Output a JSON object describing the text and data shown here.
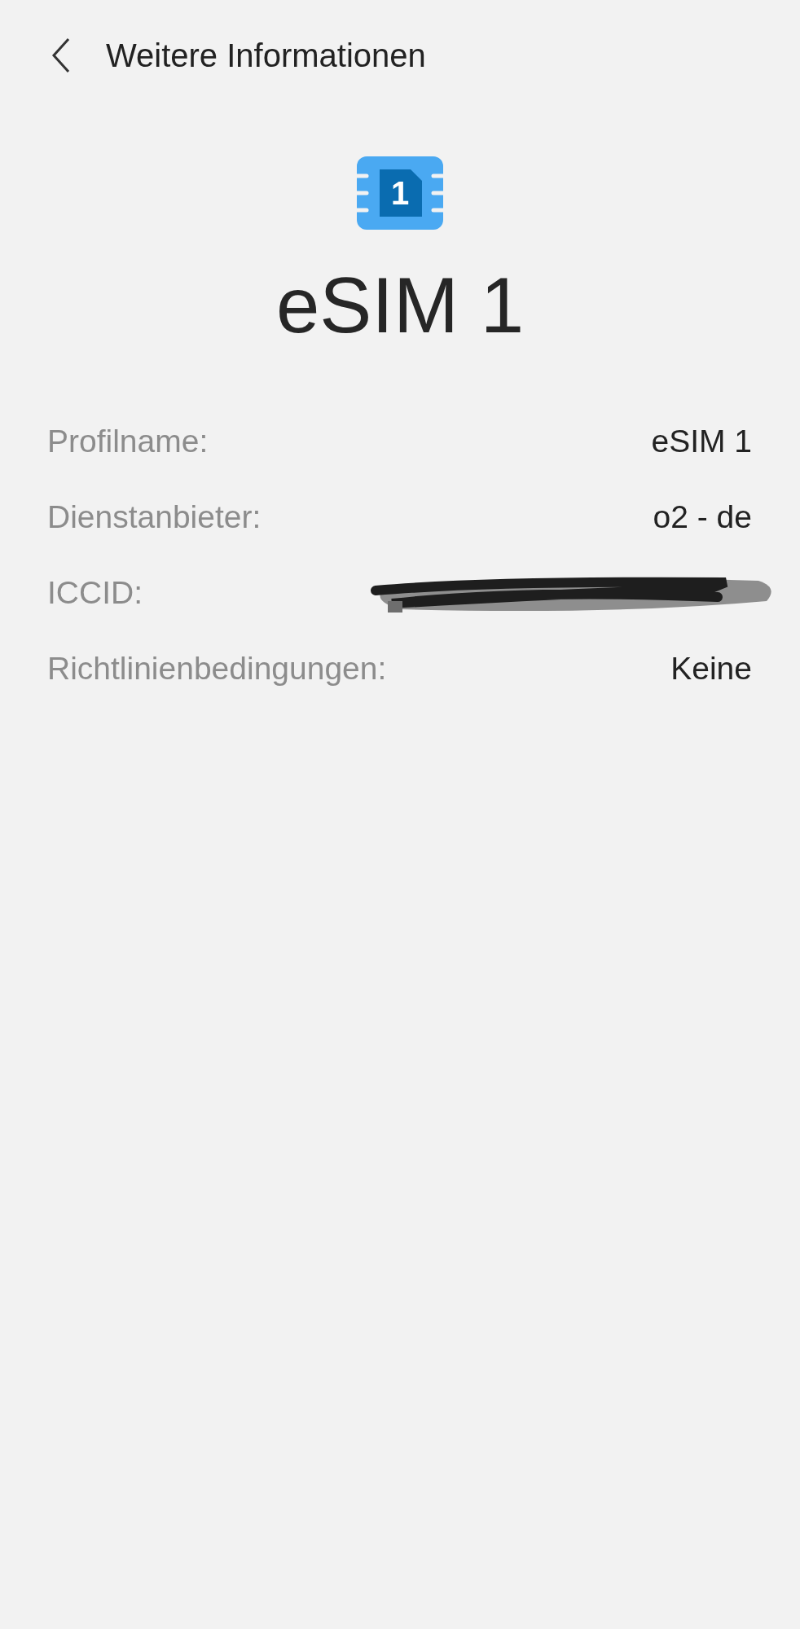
{
  "header": {
    "title": "Weitere Informationen"
  },
  "sim": {
    "badge": "1",
    "name": "eSIM 1"
  },
  "details": [
    {
      "label": "Profilname:",
      "value": "eSIM 1",
      "redacted": false
    },
    {
      "label": "Dienstanbieter:",
      "value": "o2 - de",
      "redacted": false
    },
    {
      "label": "ICCID:",
      "redacted": true
    },
    {
      "label": "Richtlinienbedingungen:",
      "value": "Keine",
      "redacted": false
    }
  ]
}
